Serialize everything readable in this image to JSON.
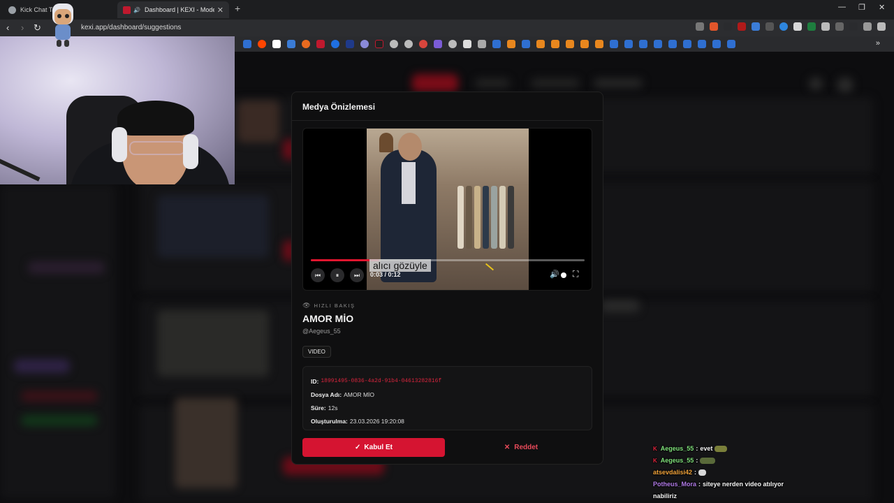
{
  "browser": {
    "tabs": [
      {
        "label": "Kick Chat Takip |",
        "active": false
      },
      {
        "label": "Dashboard | KEXI - Modern St",
        "active": true
      }
    ],
    "url": "kexi.app/dashboard/suggestions"
  },
  "modal": {
    "title": "Medya Önizlemesi",
    "player": {
      "subtitle": "alıcı gözüyle",
      "timecode": "0:03 / 0:12",
      "progress": 0.25,
      "state": "playing"
    },
    "quick_view_label": "HIZLI BAKIŞ",
    "media_title": "AMOR MİO",
    "author": "@Aegeus_55",
    "type_chip": "VIDEO",
    "meta": {
      "id_label": "ID:",
      "id_value": "18991495-0836-4a2d-91b4-04613282816f",
      "filename_label": "Dosya Adı:",
      "filename_value": "AMOR MİO",
      "duration_label": "Süre:",
      "duration_value": "12s",
      "created_label": "Oluşturulma:",
      "created_value": "23.03.2026 19:20:08"
    },
    "accept_label": "Kabul Et",
    "reject_label": "Reddet",
    "accent": "#d51431"
  },
  "chat": [
    {
      "user": "Aegeus_55",
      "text": "evet",
      "kick_badge": true
    },
    {
      "user": "Aegeus_55",
      "text": "",
      "kick_badge": true
    },
    {
      "user": "atsevdalisi42",
      "text": "",
      "kick_badge": false
    },
    {
      "user": "Potheus_Mora",
      "text": "siteye nerden video atılıyor",
      "kick_badge": false
    },
    {
      "user": "",
      "text": "nabiliriz",
      "kick_badge": false
    }
  ]
}
